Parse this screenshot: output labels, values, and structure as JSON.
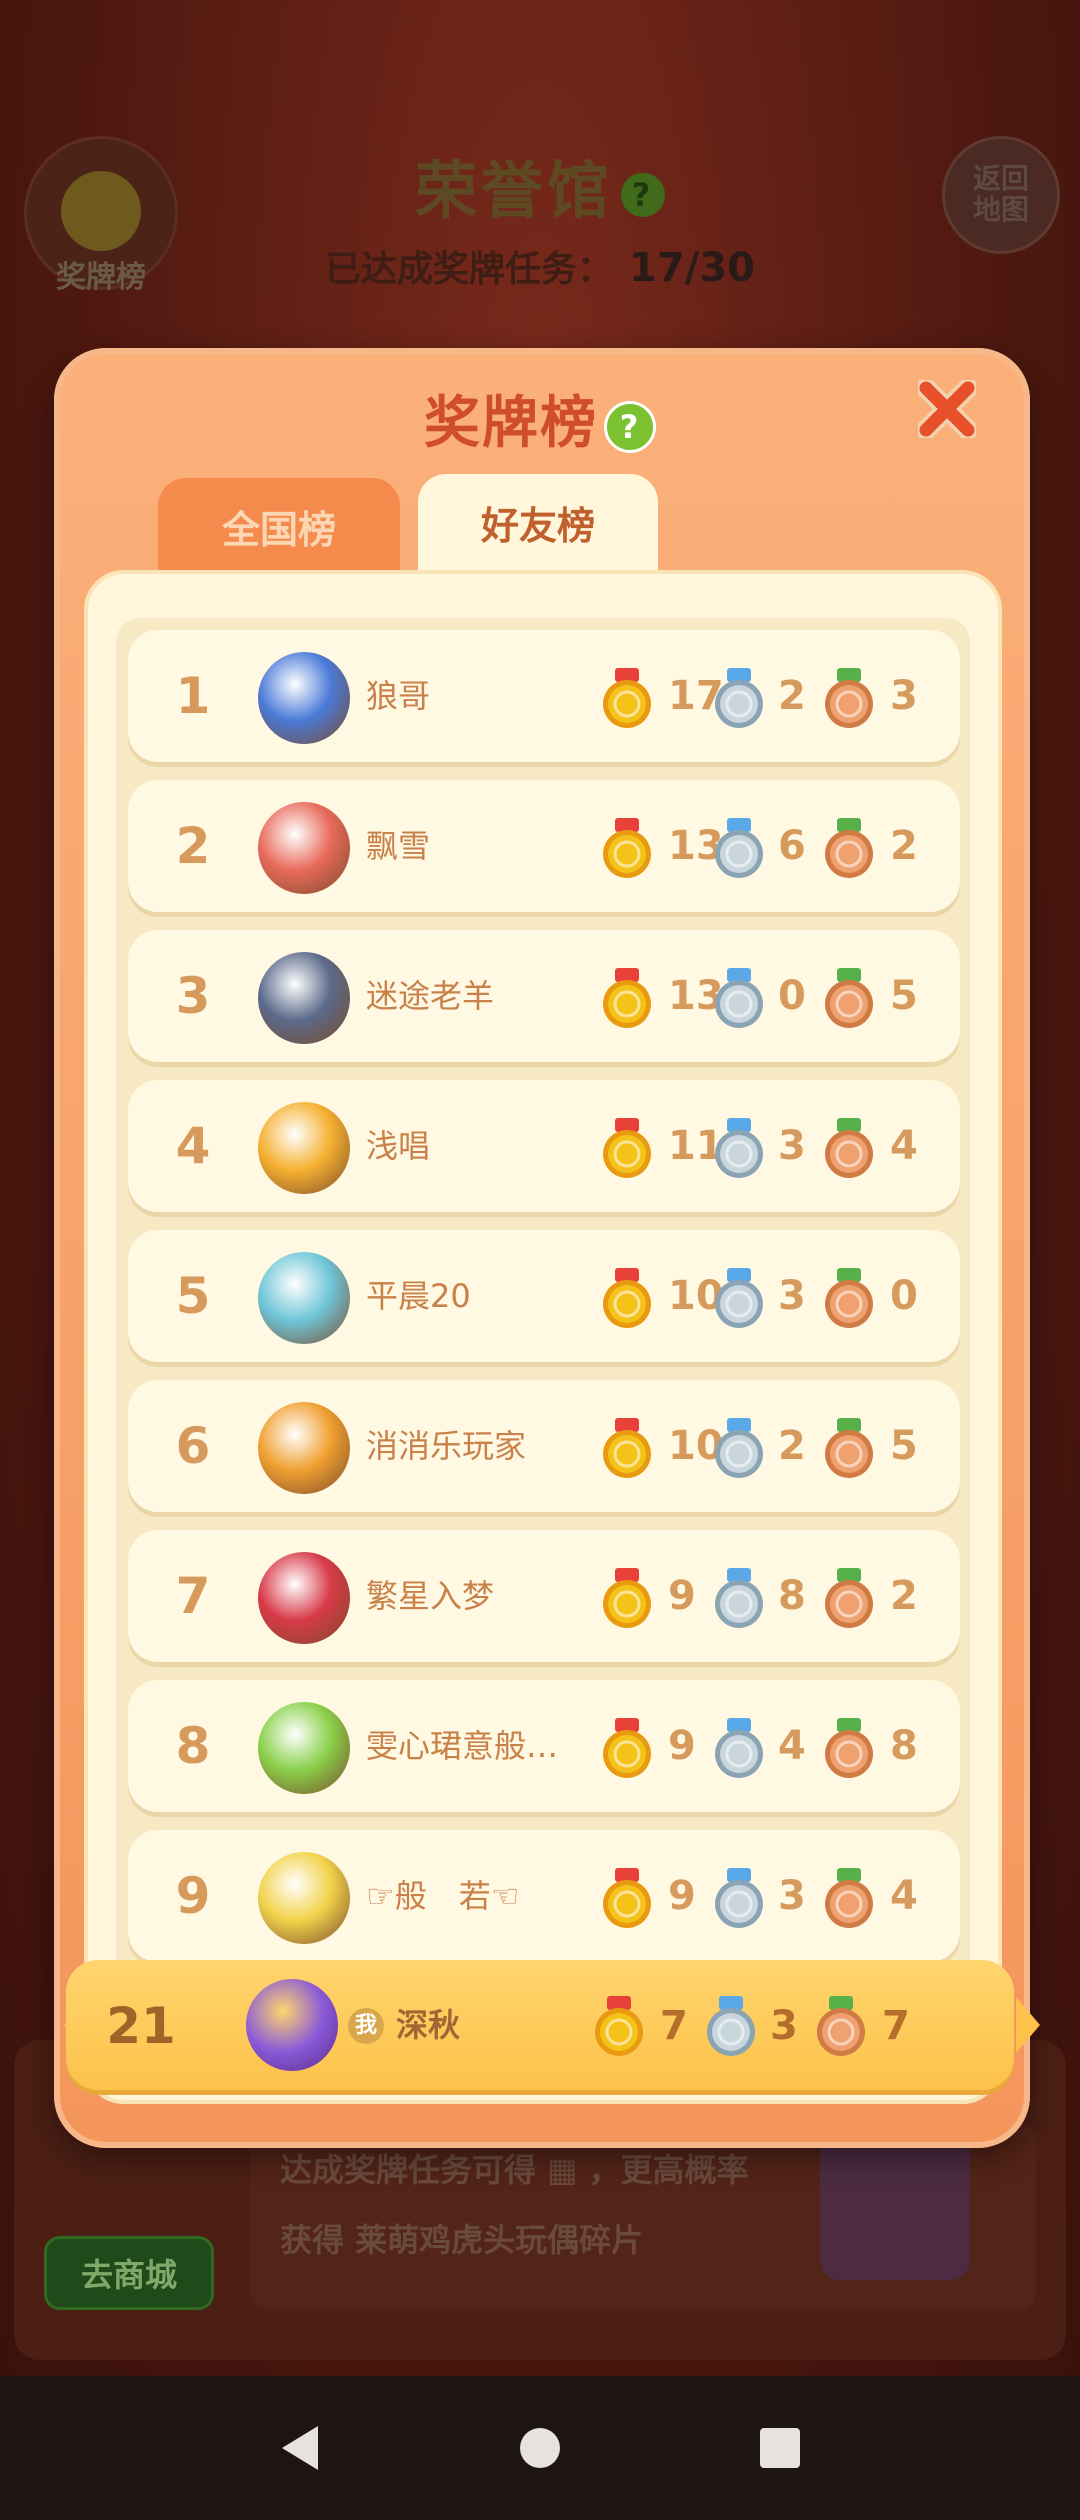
{
  "background": {
    "hall_title": "荣誉馆",
    "progress_label": "已达成奖牌任务：",
    "progress_value": "17/30",
    "medal_button_label": "奖牌榜",
    "back_button_label": "返回地图",
    "tip_line1": "达成奖牌任务可得",
    "tip_line1_suffix": "，更高概率",
    "tip_line2": "获得",
    "tip_line2_item": "莱萌鸡虎头玩偶碎片",
    "shop_button_label": "去商城"
  },
  "modal": {
    "title": "奖牌榜",
    "help_icon": "?",
    "close_icon": "close-icon"
  },
  "tabs": [
    {
      "label": "全国榜",
      "active": false
    },
    {
      "label": "好友榜",
      "active": true
    }
  ],
  "rows": [
    {
      "rank": "1",
      "name": "狼哥",
      "gold": "17",
      "silver": "2",
      "bronze": "3"
    },
    {
      "rank": "2",
      "name": "飘雪",
      "gold": "13",
      "silver": "6",
      "bronze": "2"
    },
    {
      "rank": "3",
      "name": "迷途老羊",
      "gold": "13",
      "silver": "0",
      "bronze": "5"
    },
    {
      "rank": "4",
      "name": "浅唱",
      "gold": "11",
      "silver": "3",
      "bronze": "4"
    },
    {
      "rank": "5",
      "name": "平晨20",
      "gold": "10",
      "silver": "3",
      "bronze": "0"
    },
    {
      "rank": "6",
      "name": "消消乐玩家",
      "gold": "10",
      "silver": "2",
      "bronze": "5"
    },
    {
      "rank": "7",
      "name": "繁星入梦",
      "gold": "9",
      "silver": "8",
      "bronze": "2"
    },
    {
      "rank": "8",
      "name": "雯心珺意般…",
      "gold": "9",
      "silver": "4",
      "bronze": "8"
    },
    {
      "rank": "9",
      "name": "☞般　若☜",
      "gold": "9",
      "silver": "3",
      "bronze": "4"
    }
  ],
  "me": {
    "rank": "21",
    "badge": "我",
    "name": "深秋",
    "gold": "7",
    "silver": "3",
    "bronze": "7"
  },
  "colors": {
    "accent": "#cf4d28",
    "gold": "#f5c21a",
    "silver": "#c9d6de",
    "bronze": "#f0a170"
  }
}
